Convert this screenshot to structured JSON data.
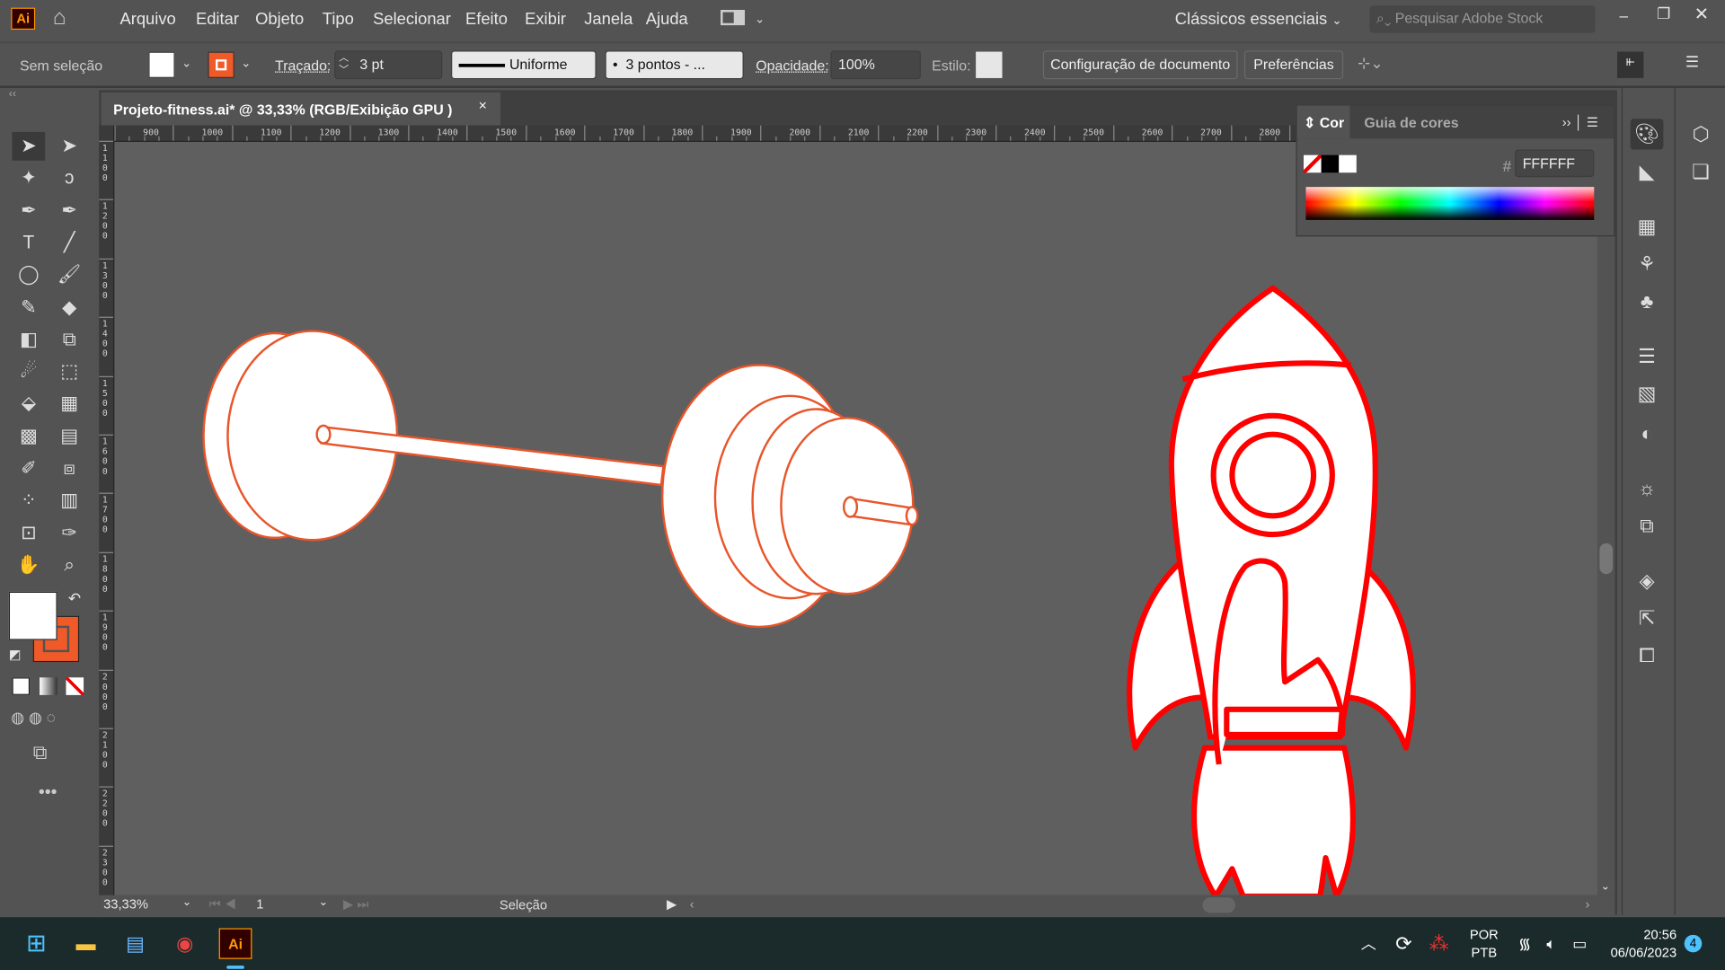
{
  "app": {
    "logo": "Ai",
    "menu": [
      "Arquivo",
      "Editar",
      "Objeto",
      "Tipo",
      "Selecionar",
      "Efeito",
      "Exibir",
      "Janela",
      "Ajuda"
    ],
    "workspace": "Clássicos essenciais",
    "search_placeholder": "Pesquisar Adobe Stock"
  },
  "controlbar": {
    "selection": "Sem seleção",
    "fill_color": "#ffffff",
    "stroke_color": "#f05a28",
    "stroke_label": "Traçado:",
    "stroke_weight": "3 pt",
    "stroke_profile": "Uniforme",
    "brush": "3 pontos - ...",
    "opacity_label": "Opacidade:",
    "opacity": "100%",
    "style_label": "Estilo:",
    "doc_setup": "Configuração de documento",
    "preferences": "Preferências"
  },
  "document": {
    "tab_title": "Projeto-fitness.ai* @ 33,33% (RGB/Exibição GPU )",
    "close": "×"
  },
  "rulers": {
    "h": [
      "900",
      "1000",
      "1100",
      "1200",
      "1300",
      "1400",
      "1500",
      "1600",
      "1700",
      "1800",
      "1900",
      "2000",
      "2100",
      "2200",
      "2300",
      "2400",
      "2500",
      "2600",
      "2700",
      "2800"
    ],
    "v": [
      "1100",
      "1200",
      "1300",
      "1400",
      "1500",
      "1600",
      "1700",
      "1800",
      "1900",
      "2000",
      "2100",
      "2200",
      "2300"
    ]
  },
  "color_panel": {
    "tabs": [
      "Cor",
      "Guia de cores"
    ],
    "hex_label": "#",
    "hex": "FFFFFF"
  },
  "status": {
    "zoom": "33,33%",
    "artboard": "1",
    "tool": "Seleção"
  },
  "artwork": {
    "barbell_stroke": "#e8552a",
    "rocket_stroke": "#ff0000",
    "fill": "#ffffff"
  },
  "tools": [
    [
      "selection-tool",
      "➤"
    ],
    [
      "direct-selection-tool",
      "➤"
    ],
    [
      "magic-wand-tool",
      "✦"
    ],
    [
      "lasso-tool",
      "ↄ"
    ],
    [
      "pen-tool",
      "✒"
    ],
    [
      "curvature-tool",
      "✒"
    ],
    [
      "type-tool",
      "T"
    ],
    [
      "line-tool",
      "╱"
    ],
    [
      "ellipse-tool",
      "◯"
    ],
    [
      "paintbrush-tool",
      "🖌"
    ],
    [
      "shaper-tool",
      "✎"
    ],
    [
      "eraser-tool",
      "◆"
    ],
    [
      "reflect-tool",
      "◧"
    ],
    [
      "scale-tool",
      "⧉"
    ],
    [
      "warp-tool",
      "☄"
    ],
    [
      "free-transform-tool",
      "⬚"
    ],
    [
      "shape-builder-tool",
      "⬙"
    ],
    [
      "perspective-grid-tool",
      "▦"
    ],
    [
      "mesh-tool",
      "▩"
    ],
    [
      "gradient-tool",
      "▤"
    ],
    [
      "eyedropper-tool",
      "✐"
    ],
    [
      "blend-tool",
      "⧈"
    ],
    [
      "symbol-sprayer-tool",
      "⁘"
    ],
    [
      "column-graph-tool",
      "▥"
    ],
    [
      "artboard-tool",
      "⊡"
    ],
    [
      "slice-tool",
      "✑"
    ],
    [
      "hand-tool",
      "✋"
    ],
    [
      "zoom-tool",
      "⌕"
    ]
  ],
  "taskbar": {
    "lang1": "POR",
    "lang2": "PTB",
    "time": "20:56",
    "date": "06/06/2023",
    "notifications": "4"
  }
}
